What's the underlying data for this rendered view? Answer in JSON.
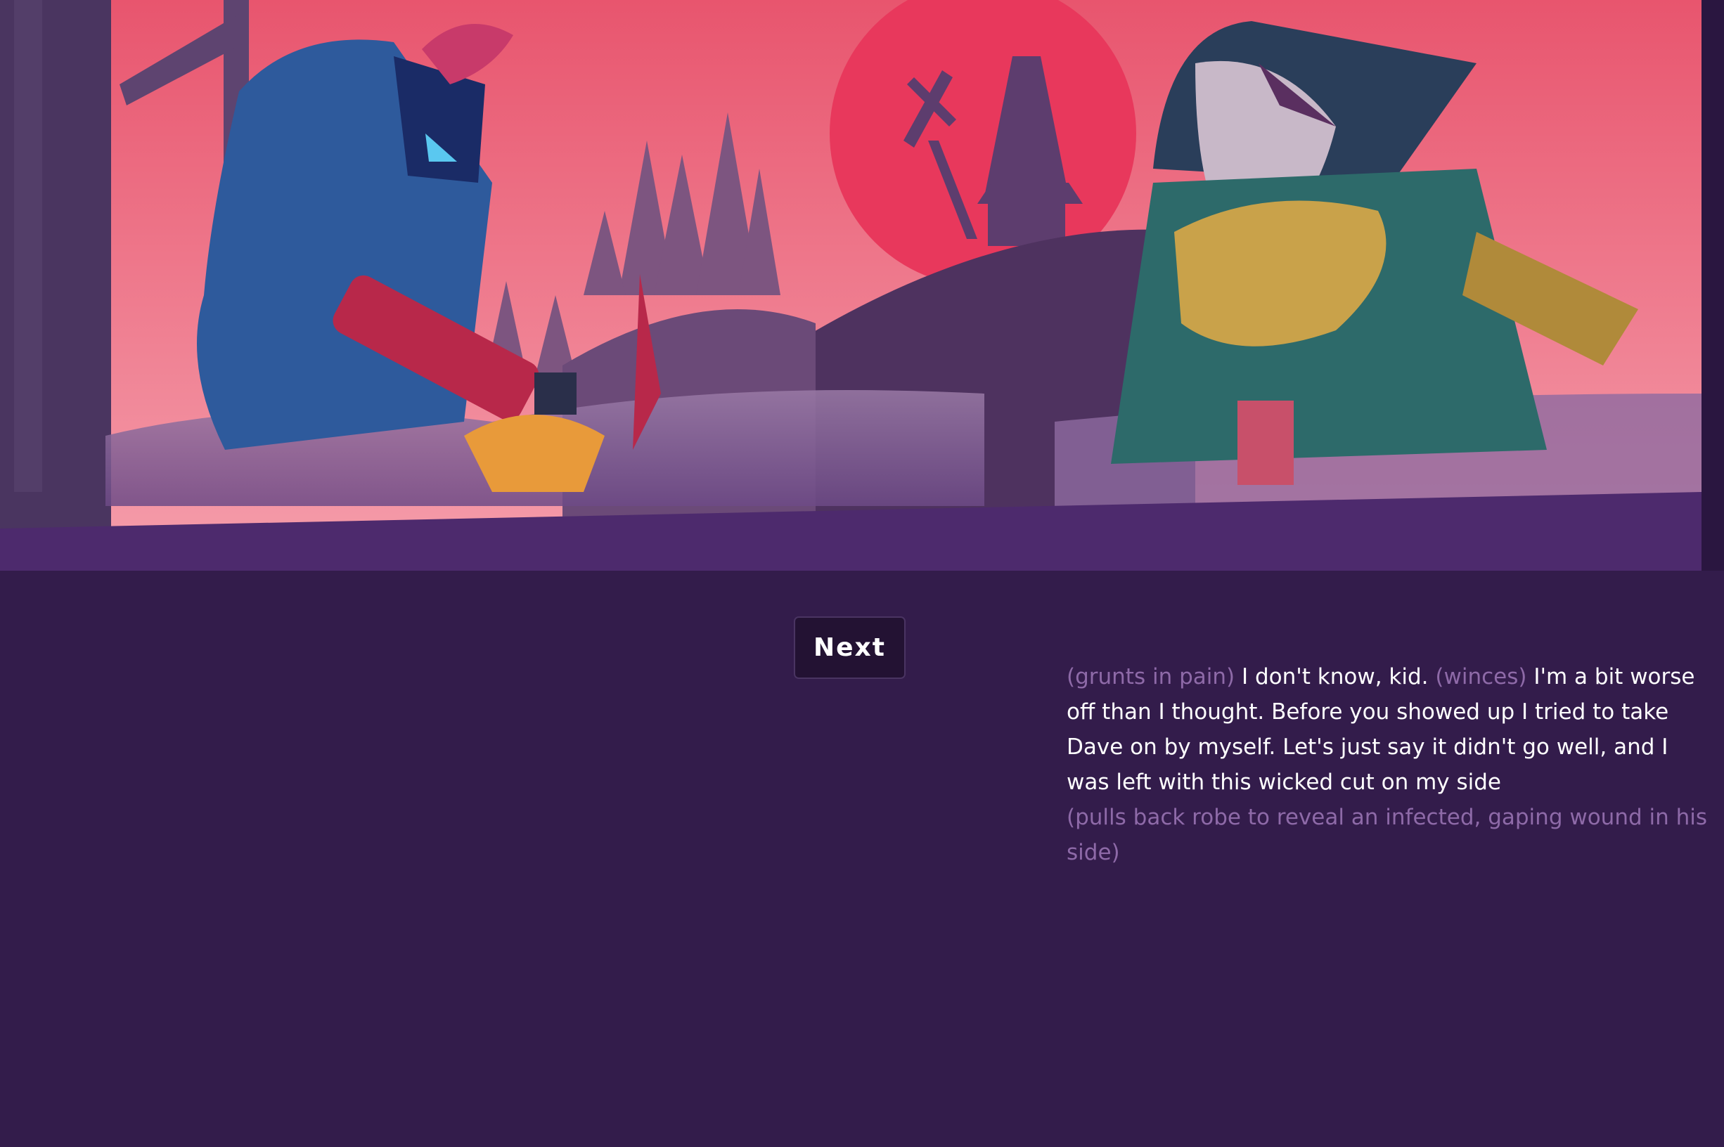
{
  "scene": {
    "colors": {
      "sky_top": "#e8556e",
      "sky_bottom": "#f49aa8",
      "sun": "#e8385c",
      "ground": "#4d2a6d",
      "background": "#331c4b"
    }
  },
  "controls": {
    "next_label": "Next"
  },
  "dialogue": {
    "line1": {
      "stage1": "(grunts in pain)",
      "speech1": " I don't know, kid. ",
      "stage2": "(winces)",
      "speech2": " I'm a bit worse off than I thought. Before you showed up I tried to take Dave on by myself. Let's just say it didn't go well, and I was left with this wicked cut on my side"
    },
    "line2": "(pulls back robe to reveal an infected, gaping wound in his side)"
  }
}
